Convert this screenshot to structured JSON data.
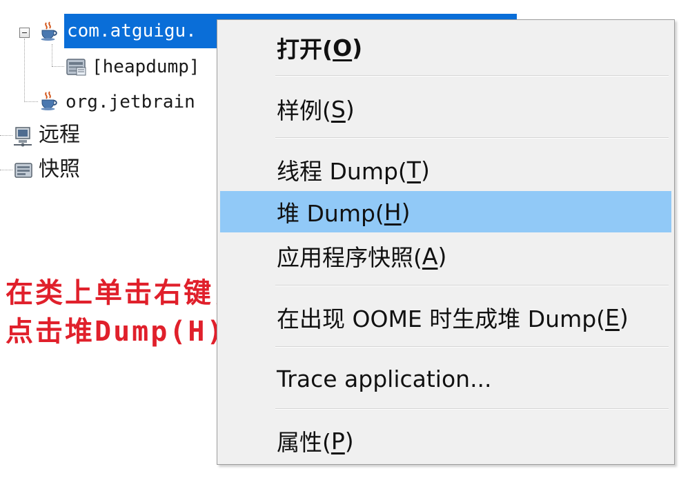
{
  "tree": {
    "nodes": [
      {
        "label": "com.atguigu.",
        "selected": true,
        "icon": "java-coffee-icon"
      },
      {
        "label": "[heapdump]",
        "icon": "heapdump-icon"
      },
      {
        "label": "org.jetbrain",
        "icon": "java-coffee-icon"
      },
      {
        "label": "远程",
        "icon": "remote-host-icon"
      },
      {
        "label": "快照",
        "icon": "snapshot-icon"
      }
    ]
  },
  "menu": {
    "items": [
      {
        "pre": "打开(",
        "mn": "O",
        "post": ")"
      },
      {
        "pre": "样例(",
        "mn": "S",
        "post": ")"
      },
      {
        "pre": "线程 Dump(",
        "mn": "T",
        "post": ")"
      },
      {
        "pre": "堆 Dump(",
        "mn": "H",
        "post": ")"
      },
      {
        "pre": "应用程序快照(",
        "mn": "A",
        "post": ")"
      },
      {
        "pre": "在出现 OOME 时生成堆 Dump(",
        "mn": "E",
        "post": ")"
      },
      {
        "pre": "Trace application...",
        "mn": "",
        "post": ""
      },
      {
        "pre": "属性(",
        "mn": "P",
        "post": ")"
      }
    ],
    "highlighted_index": 3
  },
  "annotation": {
    "line1": "在类上单击右键，",
    "line2": "点击堆Dump(H)"
  },
  "colors": {
    "selection": "#0a6ed8",
    "menu_highlight": "#91c9f7",
    "annotation": "#e0202b"
  }
}
